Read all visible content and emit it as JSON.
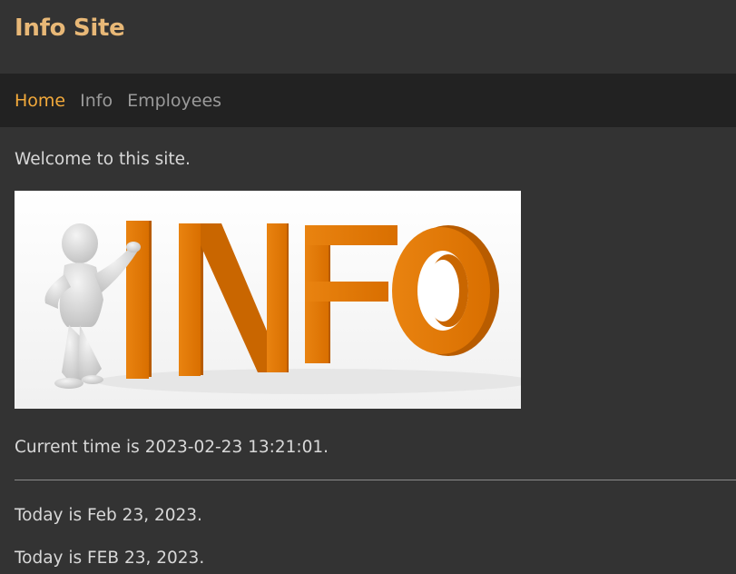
{
  "header": {
    "site_title": "Info Site"
  },
  "nav": {
    "items": [
      {
        "label": "Home",
        "active": true
      },
      {
        "label": "Info",
        "active": false
      },
      {
        "label": "Employees",
        "active": false
      }
    ]
  },
  "main": {
    "welcome_text": "Welcome to this site.",
    "hero_image": {
      "word": "INFO",
      "icon": "person-leaning-on-letters-image"
    },
    "current_time_text": "Current time is 2023-02-23 13:21:01.",
    "today_text_1": "Today is Feb 23, 2023.",
    "today_text_2": "Today is FEB 23, 2023."
  },
  "colors": {
    "background": "#333333",
    "nav_background": "#222222",
    "title": "#e8b877",
    "nav_active": "#f2a93b",
    "nav_inactive": "#9a9a9a",
    "letters": "#e07a00"
  }
}
